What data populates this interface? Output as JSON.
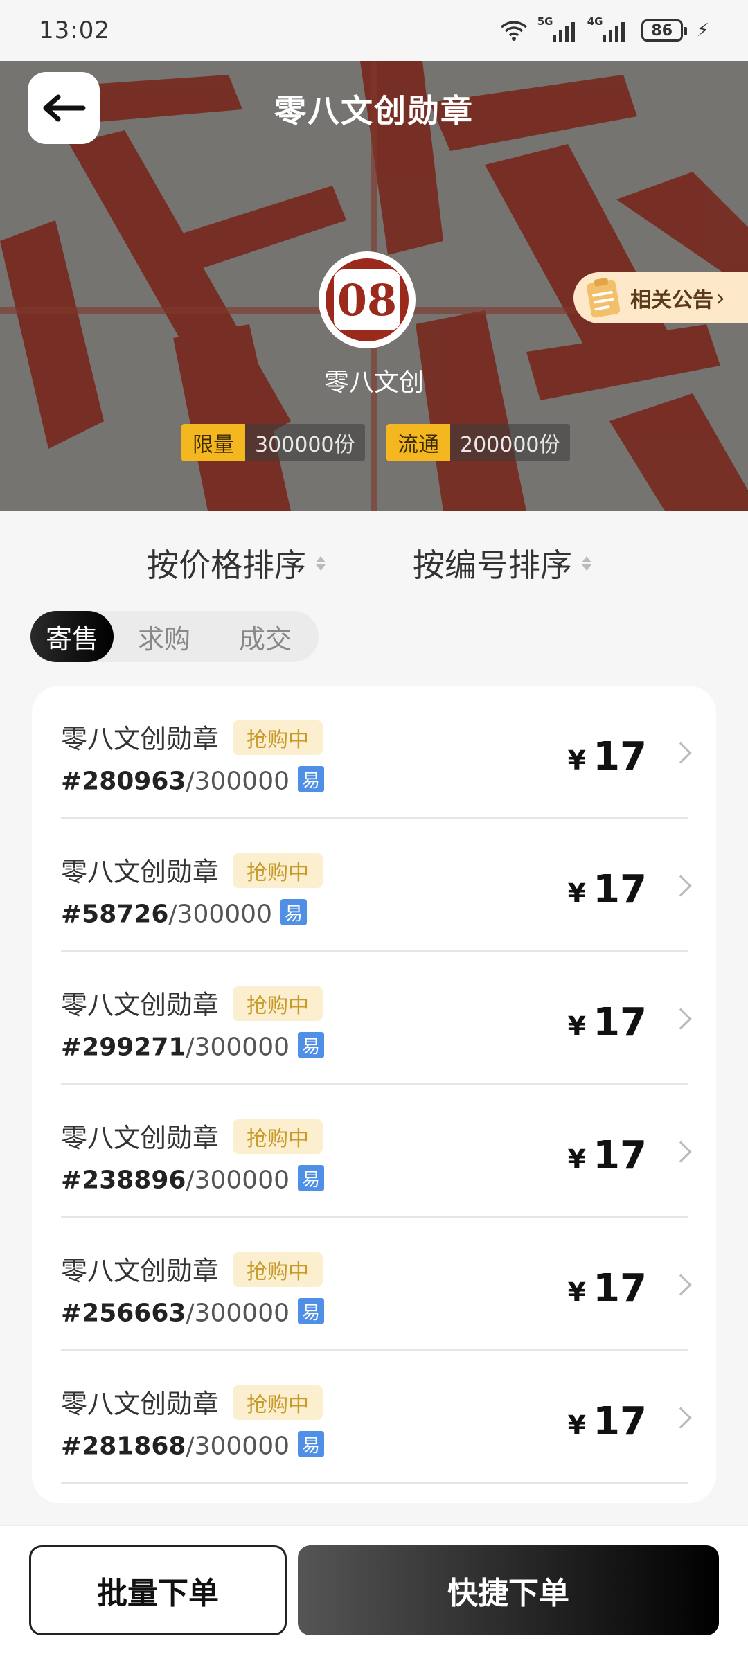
{
  "status_bar": {
    "time": "13:02",
    "battery": "86",
    "network_1": "5G",
    "network_2": "4G"
  },
  "header": {
    "title": "零八文创勋章",
    "notice_label": "相关公告"
  },
  "brand": {
    "name": "零八文创",
    "logo_text": "08"
  },
  "stats": [
    {
      "label": "限量",
      "value": "300000份"
    },
    {
      "label": "流通",
      "value": "200000份"
    }
  ],
  "sort": {
    "by_price": "按价格排序",
    "by_number": "按编号排序"
  },
  "tabs": [
    "寄售",
    "求购",
    "成交"
  ],
  "listings": [
    {
      "title": "零八文创勋章",
      "status": "抢购中",
      "number": "#280963",
      "total": "/300000",
      "tag": "易",
      "currency": "¥",
      "price": "17"
    },
    {
      "title": "零八文创勋章",
      "status": "抢购中",
      "number": "#58726",
      "total": "/300000",
      "tag": "易",
      "currency": "¥",
      "price": "17"
    },
    {
      "title": "零八文创勋章",
      "status": "抢购中",
      "number": "#299271",
      "total": "/300000",
      "tag": "易",
      "currency": "¥",
      "price": "17"
    },
    {
      "title": "零八文创勋章",
      "status": "抢购中",
      "number": "#238896",
      "total": "/300000",
      "tag": "易",
      "currency": "¥",
      "price": "17"
    },
    {
      "title": "零八文创勋章",
      "status": "抢购中",
      "number": "#256663",
      "total": "/300000",
      "tag": "易",
      "currency": "¥",
      "price": "17"
    },
    {
      "title": "零八文创勋章",
      "status": "抢购中",
      "number": "#281868",
      "total": "/300000",
      "tag": "易",
      "currency": "¥",
      "price": "17"
    }
  ],
  "bottom": {
    "batch_order": "批量下单",
    "quick_order": "快捷下单"
  },
  "colors": {
    "accent_gold": "#f5b71f",
    "badge_bg": "#fcefcf",
    "badge_text": "#c89a2a",
    "tag_blue": "#4f8fe6",
    "seal_red": "#9b2a1c"
  }
}
